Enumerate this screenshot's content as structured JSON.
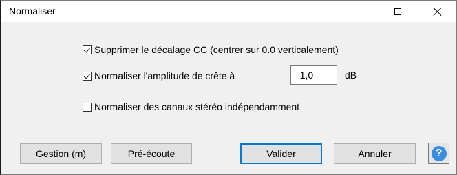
{
  "window": {
    "title": "Normaliser"
  },
  "options": [
    {
      "label": "Supprimer le décalage CC (centrer sur 0.0 verticalement)",
      "checked": true
    },
    {
      "label": "Normaliser l'amplitude de crête à",
      "checked": true
    },
    {
      "label": "Normaliser des canaux stéréo indépendamment",
      "checked": false
    }
  ],
  "peak": {
    "value": "-1,0",
    "unit": "dB"
  },
  "buttons": {
    "manage": "Gestion (m)",
    "preview": "Pré-écoute",
    "ok": "Valider",
    "cancel": "Annuler",
    "help": "?"
  }
}
